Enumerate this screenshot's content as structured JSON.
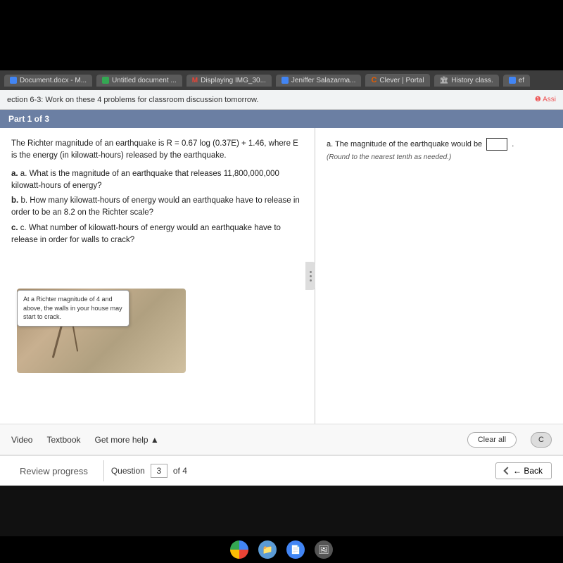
{
  "browser": {
    "tabs": [
      {
        "label": "Document.docx - M...",
        "icon_color": "#4285f4",
        "icon": "■"
      },
      {
        "label": "Untitled document ...",
        "icon_color": "#34a853",
        "icon": "■"
      },
      {
        "label": "Displaying IMG_30...",
        "icon_color": "#ea4335",
        "icon": "M"
      },
      {
        "label": "Jeniffer Salazarma...",
        "icon_color": "#4285f4",
        "icon": "■"
      },
      {
        "label": "Clever | Portal",
        "icon_color": "#e55c00",
        "icon": "C"
      },
      {
        "label": "History class.",
        "icon_color": "#8b1a1a",
        "icon": "🏛"
      },
      {
        "label": "ef",
        "icon_color": "#4285f4",
        "icon": "■"
      }
    ]
  },
  "notification": {
    "text": "ection 6-3: Work on these 4 problems for classroom discussion tomorrow.",
    "badge": "❶ Assi"
  },
  "part_header": "Part 1 of 3",
  "question": {
    "main_text": "The Richter magnitude of an earthquake is R = 0.67 log (0.37E) + 1.46, where E is the energy (in kilowatt-hours) released by the earthquake.",
    "sub_a": "a. What is the magnitude of an earthquake that releases 11,800,000,000 kilowatt-hours of energy?",
    "sub_b": "b. How many kilowatt-hours of energy would an earthquake have to release in order to be an 8.2 on the Richter scale?",
    "sub_c": "c. What number of kilowatt-hours of energy would an earthquake have to release in order for walls to crack?",
    "tooltip": "At a Richter magnitude of 4 and above, the walls in your house may start to crack.",
    "answer_prompt": "a. The magnitude of the earthquake would be",
    "round_note": "(Round to the nearest tenth as needed.)"
  },
  "toolbar": {
    "video_label": "Video",
    "textbook_label": "Textbook",
    "more_help_label": "Get more help ▲",
    "clear_all_label": "Clear all",
    "c_label": "C"
  },
  "footer": {
    "review_progress_label": "Review progress",
    "question_label": "Question",
    "question_number": "3",
    "of_label": "of 4",
    "back_label": "← Back"
  },
  "taskbar": {
    "icons": [
      "🌐",
      "📁",
      "📄",
      "🖼"
    ]
  }
}
